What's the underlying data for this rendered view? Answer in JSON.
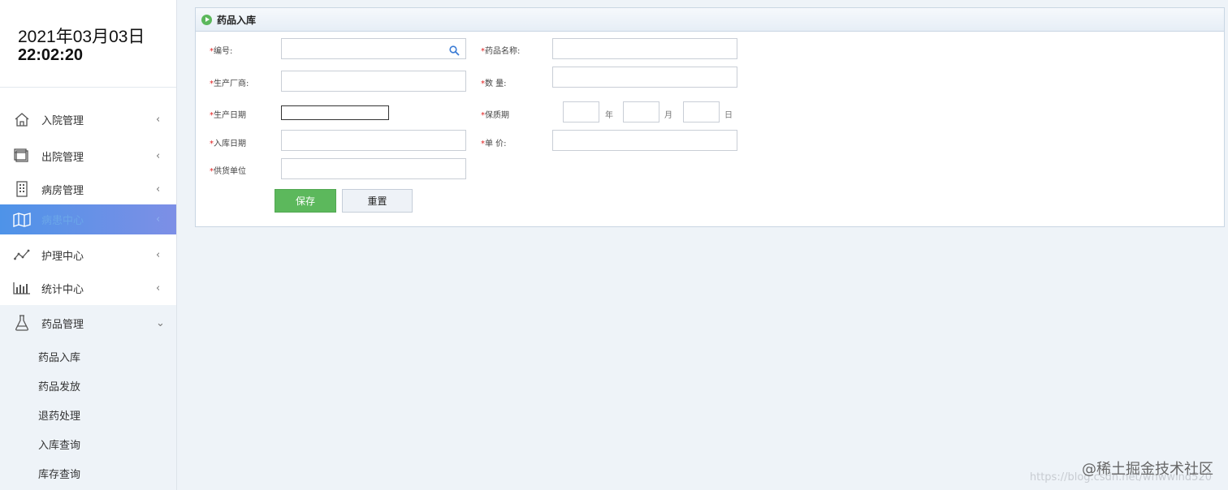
{
  "clock": {
    "date": "2021年03月03日",
    "time": "22:02:20"
  },
  "menu": [
    {
      "label": "入院管理",
      "icon": "home-icon",
      "arrow": "‹"
    },
    {
      "label": "出院管理",
      "icon": "window-icon",
      "arrow": "‹"
    },
    {
      "label": "病房管理",
      "icon": "building-icon",
      "arrow": "‹"
    },
    {
      "label": "病患中心",
      "icon": "map-icon",
      "arrow": "‹"
    },
    {
      "label": "护理中心",
      "icon": "line-chart-icon",
      "arrow": "‹"
    },
    {
      "label": "统计中心",
      "icon": "bar-chart-icon",
      "arrow": "‹"
    },
    {
      "label": "药品管理",
      "icon": "flask-icon",
      "arrow": "⌄"
    }
  ],
  "submenu": [
    "药品入库",
    "药品发放",
    "退药处理",
    "入库查询",
    "库存查询"
  ],
  "panel": {
    "title": "药品入库"
  },
  "form": {
    "required_mark": "*",
    "code_label": "编号:",
    "name_label": "药品名称:",
    "maker_label": "生产厂商:",
    "qty_label": "数  量:",
    "prod_date_label": "生产日期",
    "shelf_label": "保质期",
    "in_date_label": "入库日期",
    "price_label": "单  价:",
    "supplier_label": "供货单位",
    "unit_year": "年",
    "unit_month": "月",
    "unit_day": "日"
  },
  "buttons": {
    "save": "保存",
    "reset": "重置"
  },
  "watermark": {
    "text": "@稀土掘金技术社区",
    "url": "https://blog.csdn.net/whwwind520"
  },
  "colors": {
    "active_menu": "#5a8fe6",
    "save_button": "#5cb85c",
    "required": "#e02020"
  }
}
